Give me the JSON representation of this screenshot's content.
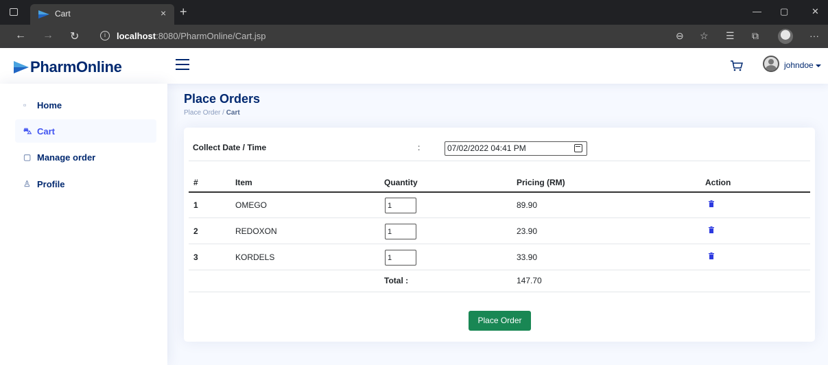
{
  "browser": {
    "tab_title": "Cart",
    "tab_close": "×",
    "tab_new": "+",
    "url_host": "localhost",
    "url_rest": ":8080/PharmOnline/Cart.jsp",
    "win_minimize": "—",
    "win_restore": "▢",
    "win_close": "✕",
    "more": "···"
  },
  "app": {
    "brand": "PharmOnline",
    "username": "johndoe"
  },
  "sidebar": {
    "items": [
      {
        "label": "Home",
        "icon": "grid-icon"
      },
      {
        "label": "Cart",
        "icon": "cart-icon"
      },
      {
        "label": "Manage order",
        "icon": "clipboard-icon"
      },
      {
        "label": "Profile",
        "icon": "person-icon"
      }
    ]
  },
  "page": {
    "title": "Place Orders",
    "breadcrumb_parent": "Place Order",
    "breadcrumb_sep": "/",
    "breadcrumb_current": "Cart"
  },
  "form": {
    "collect_label": "Collect Date / Time",
    "colon": ":",
    "collect_value": "07/02/2022 04:41 PM"
  },
  "table": {
    "headers": [
      "#",
      "Item",
      "Quantity",
      "Pricing (RM)",
      "Action"
    ],
    "rows": [
      {
        "num": "1",
        "item": "OMEGO",
        "qty": "1",
        "price": "89.90"
      },
      {
        "num": "2",
        "item": "REDOXON",
        "qty": "1",
        "price": "23.90"
      },
      {
        "num": "3",
        "item": "KORDELS",
        "qty": "1",
        "price": "33.90"
      }
    ],
    "total_label": "Total :",
    "total_value": "147.70"
  },
  "actions": {
    "place_order": "Place Order"
  },
  "colors": {
    "primary": "#4154f1",
    "navy": "#012970",
    "button_green": "#198754",
    "trash_blue": "#2d3ae0"
  }
}
